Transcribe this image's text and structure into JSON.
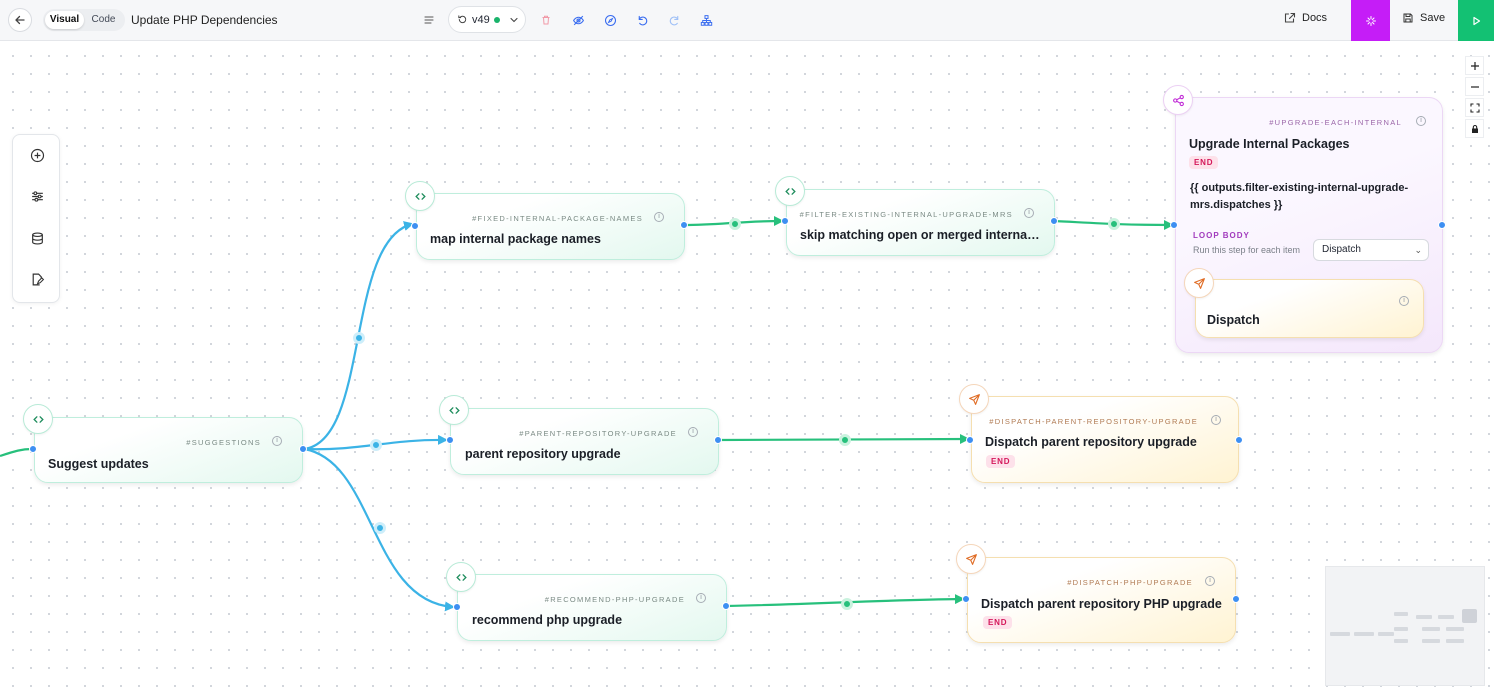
{
  "toolbar": {
    "back_icon": "arrow-left-icon",
    "mode_visual": "Visual",
    "mode_code": "Code",
    "title": "Update PHP Dependencies",
    "version": "v49",
    "docs_label": "Docs",
    "save_label": "Save",
    "icons": [
      "menu-lines-icon",
      "history-icon",
      "trash-icon",
      "eye-off-icon",
      "compass-icon",
      "undo-icon",
      "redo-icon",
      "tree-layout-icon",
      "external-link-icon",
      "sparkle-icon",
      "floppy-disk-icon",
      "play-icon"
    ]
  },
  "colors": {
    "ai_accent": "#c51df7",
    "run_accent": "#13c173",
    "edge_blue": "#3bb3e6",
    "edge_green": "#27c07c",
    "handle_blue": "#3d8ff2",
    "end_badge": "#d4185a"
  },
  "left_tools": [
    "plus-circle-icon",
    "sliders-icon",
    "database-icon",
    "file-edit-icon"
  ],
  "zoom_tools": [
    "zoom-in-icon",
    "zoom-out-icon",
    "fit-view-icon",
    "lock-icon"
  ],
  "nodes": {
    "suggestions": {
      "id": "#SUGGESTIONS",
      "label": "Suggest updates",
      "icon": "code-brackets-icon"
    },
    "fixed_internal": {
      "id": "#FIXED-INTERNAL-PACKAGE-NAMES",
      "label": "map internal package names",
      "icon": "code-brackets-icon"
    },
    "filter_existing": {
      "id": "#FILTER-EXISTING-INTERNAL-UPGRADE-MRS",
      "label": "skip matching open or merged internal p…",
      "icon": "code-brackets-icon"
    },
    "upgrade_each": {
      "id": "#UPGRADE-EACH-INTERNAL",
      "label": "Upgrade Internal Packages",
      "end": "END",
      "expression": "{{ outputs.filter-existing-internal-upgrade-mrs.dispatches }}",
      "loop_body_title": "LOOP BODY",
      "loop_body_desc": "Run this step for each item",
      "loop_select": "Dispatch",
      "icon": "share-icon"
    },
    "dispatch_inner": {
      "label": "Dispatch",
      "icon": "send-icon"
    },
    "parent_repo": {
      "id": "#PARENT-REPOSITORY-UPGRADE",
      "label": "parent repository upgrade",
      "icon": "code-brackets-icon"
    },
    "dispatch_parent": {
      "id": "#DISPATCH-PARENT-REPOSITORY-UPGRADE",
      "label": "Dispatch parent repository upgrade",
      "end": "END",
      "icon": "send-icon"
    },
    "recommend_php": {
      "id": "#RECOMMEND-PHP-UPGRADE",
      "label": "recommend php upgrade",
      "icon": "code-brackets-icon"
    },
    "dispatch_php": {
      "id": "#DISPATCH-PHP-UPGRADE",
      "label": "Dispatch parent repository PHP upgrade",
      "end": "END",
      "icon": "send-icon"
    }
  }
}
